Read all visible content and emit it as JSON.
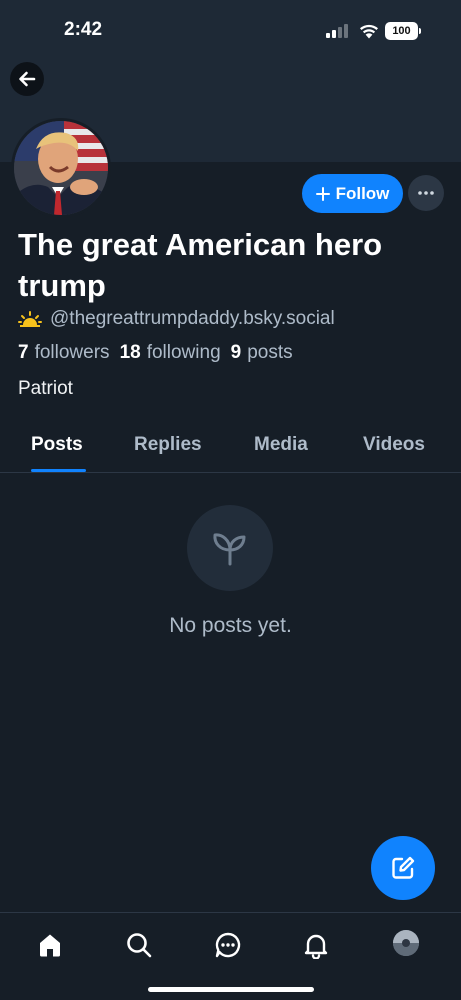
{
  "status_bar": {
    "time": "2:42",
    "battery": "100"
  },
  "profile": {
    "display_name": "The great American hero trump",
    "handle": "@thegreattrumpdaddy.bsky.social",
    "bio": "Patriot",
    "stats": {
      "followers_count": "7",
      "followers_label": "followers",
      "following_count": "18",
      "following_label": "following",
      "posts_count": "9",
      "posts_label": "posts"
    }
  },
  "actions": {
    "follow_label": "Follow",
    "more_icon": "more-horizontal-icon"
  },
  "tabs": [
    {
      "label": "Posts",
      "active": true
    },
    {
      "label": "Replies",
      "active": false
    },
    {
      "label": "Media",
      "active": false
    },
    {
      "label": "Videos",
      "active": false
    }
  ],
  "empty_state": {
    "icon": "sprout-icon",
    "text": "No posts yet."
  },
  "bottom_nav": [
    "home-icon",
    "search-icon",
    "chat-icon",
    "bell-icon",
    "avatar"
  ],
  "colors": {
    "background": "#161e27",
    "accent": "#1083fe",
    "muted_text": "#aebbc9"
  }
}
